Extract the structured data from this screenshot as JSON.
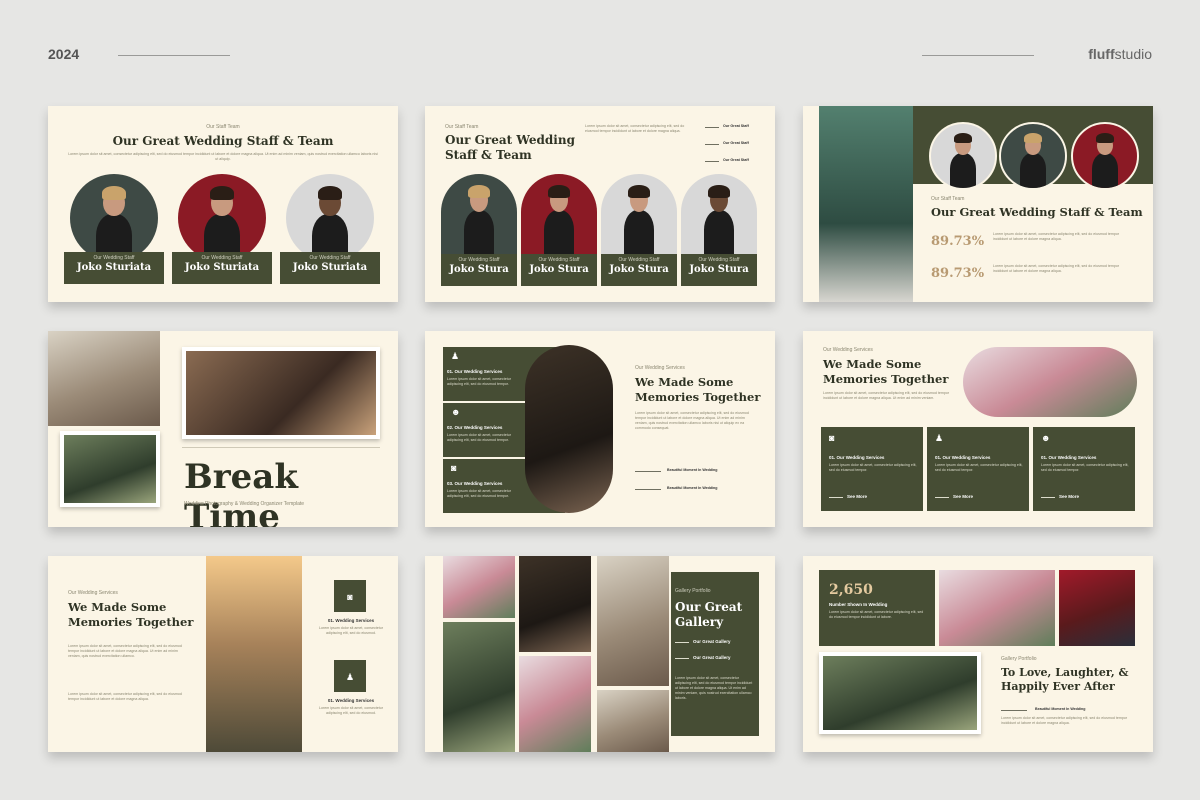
{
  "header": {
    "year": "2024",
    "brand_bold": "fluff",
    "brand_regular": "studio"
  },
  "s1": {
    "kicker": "Our Staff Team",
    "title": "Our Great Wedding Staff & Team",
    "body": "Lorem ipsum dolor sit amet, consectetur adipiscing elit, sed do eiusmod tempor incididunt ut labore et dolore magna aliqua. Ut enim ad minim veniam, quis nostrud exercitation ullamco laboris nisi ut aliquip.",
    "members": [
      {
        "role": "Our Wedding Staff",
        "name": "Joko Sturiata"
      },
      {
        "role": "Our Wedding Staff",
        "name": "Joko Sturiata"
      },
      {
        "role": "Our Wedding Staff",
        "name": "Joko Sturiata"
      }
    ]
  },
  "s2": {
    "kicker": "Our Staff Team",
    "title": "Our Great Wedding Staff & Team",
    "body": "Lorem ipsum dolor sit amet, consectetur adipiscing elit, sed do eiusmod tempor incididunt ut labore et dolore magna aliqua.",
    "links": [
      "Our Great Staff",
      "Our Great Staff",
      "Our Great Staff"
    ],
    "members": [
      {
        "role": "Our Wedding Staff",
        "name": "Joko Stura"
      },
      {
        "role": "Our Wedding Staff",
        "name": "Joko Stura"
      },
      {
        "role": "Our Wedding Staff",
        "name": "Joko Stura"
      },
      {
        "role": "Our Wedding Staff",
        "name": "Joko Stura"
      }
    ]
  },
  "s3": {
    "kicker": "Our Staff Team",
    "title": "Our Great Wedding Staff & Team",
    "stats": [
      {
        "value": "89.73%",
        "text": "Lorem ipsum dolor sit amet, consectetur adipiscing elit, sed do eiusmod tempor incididunt ut labore et dolore magna aliqua."
      },
      {
        "value": "89.73%",
        "text": "Lorem ipsum dolor sit amet, consectetur adipiscing elit, sed do eiusmod tempor incididunt ut labore et dolore magna aliqua."
      }
    ]
  },
  "s4": {
    "title": "Break Time",
    "subtitle": "Wedding Photography & Wedding Organizer Template"
  },
  "s5": {
    "kicker": "Our Wedding Services",
    "title": "We Made Some Memories Together",
    "body": "Lorem ipsum dolor sit amet, consectetur adipiscing elit, sed do eiusmod tempor incididunt ut labore et dolore magna aliqua. Ut enim ad minim veniam, quis nostrud exercitation ullamco laboris nisi ut aliquip ex ea commodo consequat.",
    "services": [
      {
        "label": "01. Our Wedding Services",
        "text": "Lorem ipsum dolor sit amet, consectetur adipiscing elit, sed do eiusmod tempor.",
        "icon": "suit-icon"
      },
      {
        "label": "02. Our Wedding Services",
        "text": "Lorem ipsum dolor sit amet, consectetur adipiscing elit, sed do eiusmod tempor.",
        "icon": "people-icon"
      },
      {
        "label": "03. Our Wedding Services",
        "text": "Lorem ipsum dolor sit amet, consectetur adipiscing elit, sed do eiusmod tempor.",
        "icon": "camera-icon"
      }
    ],
    "moments": [
      "Beautiful Moment In Wedding",
      "Beautiful Moment In Wedding"
    ]
  },
  "s6": {
    "kicker": "Our Wedding Services",
    "title": "We Made Some Memories Together",
    "body": "Lorem ipsum dolor sit amet, consectetur adipiscing elit, sed do eiusmod tempor incididunt ut labore et dolore magna aliqua. Ut enim ad minim veniam.",
    "cards": [
      {
        "label": "01. Our Wedding Services",
        "text": "Lorem ipsum dolor sit amet, consectetur adipiscing elit, sed do eiusmod tempor.",
        "cta": "See More",
        "icon": "camera-icon"
      },
      {
        "label": "01. Our Wedding Services",
        "text": "Lorem ipsum dolor sit amet, consectetur adipiscing elit, sed do eiusmod tempor.",
        "cta": "See More",
        "icon": "suit-icon"
      },
      {
        "label": "01. Our Wedding Services",
        "text": "Lorem ipsum dolor sit amet, consectetur adipiscing elit, sed do eiusmod tempor.",
        "cta": "See More",
        "icon": "people-icon"
      }
    ]
  },
  "s7": {
    "kicker": "Our Wedding Services",
    "title": "We Made Some Memories Together",
    "body1": "Lorem ipsum dolor sit amet, consectetur adipiscing elit, sed do eiusmod tempor incididunt ut labore et dolore magna aliqua. Ut enim ad minim veniam, quis nostrud exercitation ullamco.",
    "body2": "Lorem ipsum dolor sit amet, consectetur adipiscing elit, sed do eiusmod tempor incididunt ut labore et dolore magna aliqua.",
    "services": [
      {
        "label": "01. Wedding Services",
        "text": "Lorem ipsum dolor sit amet, consectetur adipiscing elit, sed do eiusmod.",
        "icon": "camera-icon"
      },
      {
        "label": "01. Wedding Services",
        "text": "Lorem ipsum dolor sit amet, consectetur adipiscing elit, sed do eiusmod.",
        "icon": "suit-icon"
      }
    ]
  },
  "s8": {
    "kicker": "Gallery Portfolio",
    "title": "Our Great Gallery",
    "links": [
      "Our Great Gallery",
      "Our Great Gallery"
    ],
    "body": "Lorem ipsum dolor sit amet, consectetur adipiscing elit, sed do eiusmod tempor incididunt ut labore et dolore magna aliqua. Ut enim ad minim veniam, quis nostrud exercitation ullamco laboris."
  },
  "s9": {
    "stat": "2,650",
    "stat_label": "Number Shown In Wedding",
    "stat_text": "Lorem ipsum dolor sit amet, consectetur adipiscing elit, sed do eiusmod tempor incididunt ut labore.",
    "kicker": "Gallery Portfolio",
    "title": "To Love, Laughter, & Happily Ever After",
    "moment": "Beautiful Moment In Wedding",
    "body": "Lorem ipsum dolor sit amet, consectetur adipiscing elit, sed do eiusmod tempor incididunt ut labore et dolore magna aliqua."
  }
}
